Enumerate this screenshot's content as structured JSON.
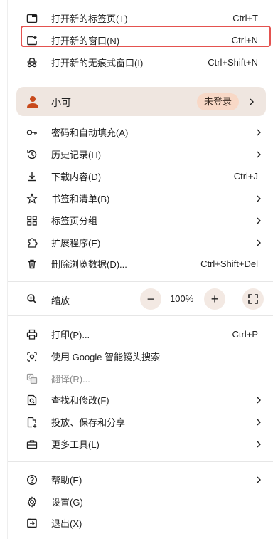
{
  "menu": {
    "new_tab": {
      "label": "打开新的标签页(T)",
      "shortcut": "Ctrl+T",
      "icon": "new-tab-icon"
    },
    "new_window": {
      "label": "打开新的窗口(N)",
      "shortcut": "Ctrl+N",
      "icon": "new-window-icon",
      "highlighted": true,
      "highlight_color": "#e4524f"
    },
    "incognito": {
      "label": "打开新的无痕式窗口(I)",
      "shortcut": "Ctrl+Shift+N",
      "icon": "incognito-icon"
    },
    "profile": {
      "name": "小可",
      "status_badge": "未登录",
      "icon": "avatar-icon"
    },
    "passwords": {
      "label": "密码和自动填充(A)",
      "icon": "key-icon"
    },
    "history": {
      "label": "历史记录(H)",
      "icon": "history-icon"
    },
    "downloads": {
      "label": "下载内容(D)",
      "shortcut": "Ctrl+J",
      "icon": "download-icon"
    },
    "bookmarks": {
      "label": "书签和清单(B)",
      "icon": "star-icon"
    },
    "tab_groups": {
      "label": "标签页分组",
      "icon": "grid-icon"
    },
    "extensions": {
      "label": "扩展程序(E)",
      "icon": "puzzle-icon"
    },
    "clear_data": {
      "label": "删除浏览数据(D)...",
      "shortcut": "Ctrl+Shift+Del",
      "icon": "trash-icon"
    },
    "zoom": {
      "label": "缩放",
      "value": "100%",
      "minus": "−",
      "plus": "+",
      "icon": "zoom-icon"
    },
    "print": {
      "label": "打印(P)...",
      "shortcut": "Ctrl+P",
      "icon": "print-icon"
    },
    "lens": {
      "label": "使用 Google 智能镜头搜索",
      "icon": "lens-icon"
    },
    "translate": {
      "label": "翻译(R)...",
      "icon": "translate-icon",
      "disabled": true
    },
    "find_edit": {
      "label": "查找和修改(F)",
      "icon": "find-icon"
    },
    "cast_save_share": {
      "label": "投放、保存和分享",
      "icon": "cast-icon"
    },
    "more_tools": {
      "label": "更多工具(L)",
      "icon": "toolbox-icon"
    },
    "help": {
      "label": "帮助(E)",
      "icon": "help-icon"
    },
    "settings": {
      "label": "设置(G)",
      "icon": "settings-icon"
    },
    "exit": {
      "label": "退出(X)",
      "icon": "exit-icon"
    }
  }
}
